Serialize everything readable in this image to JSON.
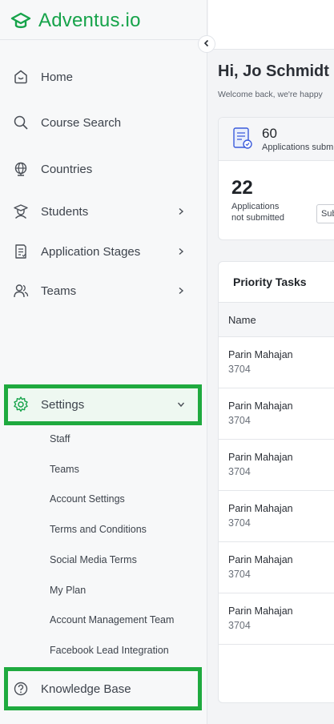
{
  "brand": {
    "name": "Adventus.io",
    "color": "#16a34a"
  },
  "sidebar": {
    "items": [
      {
        "label": "Home",
        "icon": "home-icon"
      },
      {
        "label": "Course Search",
        "icon": "search-icon"
      },
      {
        "label": "Countries",
        "icon": "globe-icon"
      },
      {
        "label": "Students",
        "icon": "graduate-icon",
        "expandable": true
      },
      {
        "label": "Application Stages",
        "icon": "document-icon",
        "expandable": true
      },
      {
        "label": "Teams",
        "icon": "users-icon",
        "expandable": true
      },
      {
        "label": "Settings",
        "icon": "gear-icon",
        "expanded": true
      }
    ],
    "settings_sub": [
      "Staff",
      "Teams",
      "Account Settings",
      "Terms and Conditions",
      "Social Media Terms",
      "My Plan",
      "Account Management Team",
      "Facebook Lead Integration"
    ],
    "knowledge_base": {
      "label": "Knowledge Base",
      "icon": "help-icon"
    },
    "highlight_color": "#1faa3f"
  },
  "main": {
    "greeting": "Hi, Jo Schmidt",
    "welcome": "Welcome back, we're happy",
    "stats": {
      "submitted_count": "60",
      "submitted_label": "Applications subm",
      "not_submitted_count": "22",
      "not_submitted_label_1": "Applications",
      "not_submitted_label_2": "not submitted",
      "button_label": "Sub"
    },
    "priority": {
      "title": "Priority Tasks",
      "column_name": "Name",
      "rows": [
        {
          "name": "Parin Mahajan",
          "id": "3704"
        },
        {
          "name": "Parin Mahajan",
          "id": "3704"
        },
        {
          "name": "Parin Mahajan",
          "id": "3704"
        },
        {
          "name": "Parin Mahajan",
          "id": "3704"
        },
        {
          "name": "Parin Mahajan",
          "id": "3704"
        },
        {
          "name": "Parin Mahajan",
          "id": "3704"
        }
      ]
    }
  }
}
